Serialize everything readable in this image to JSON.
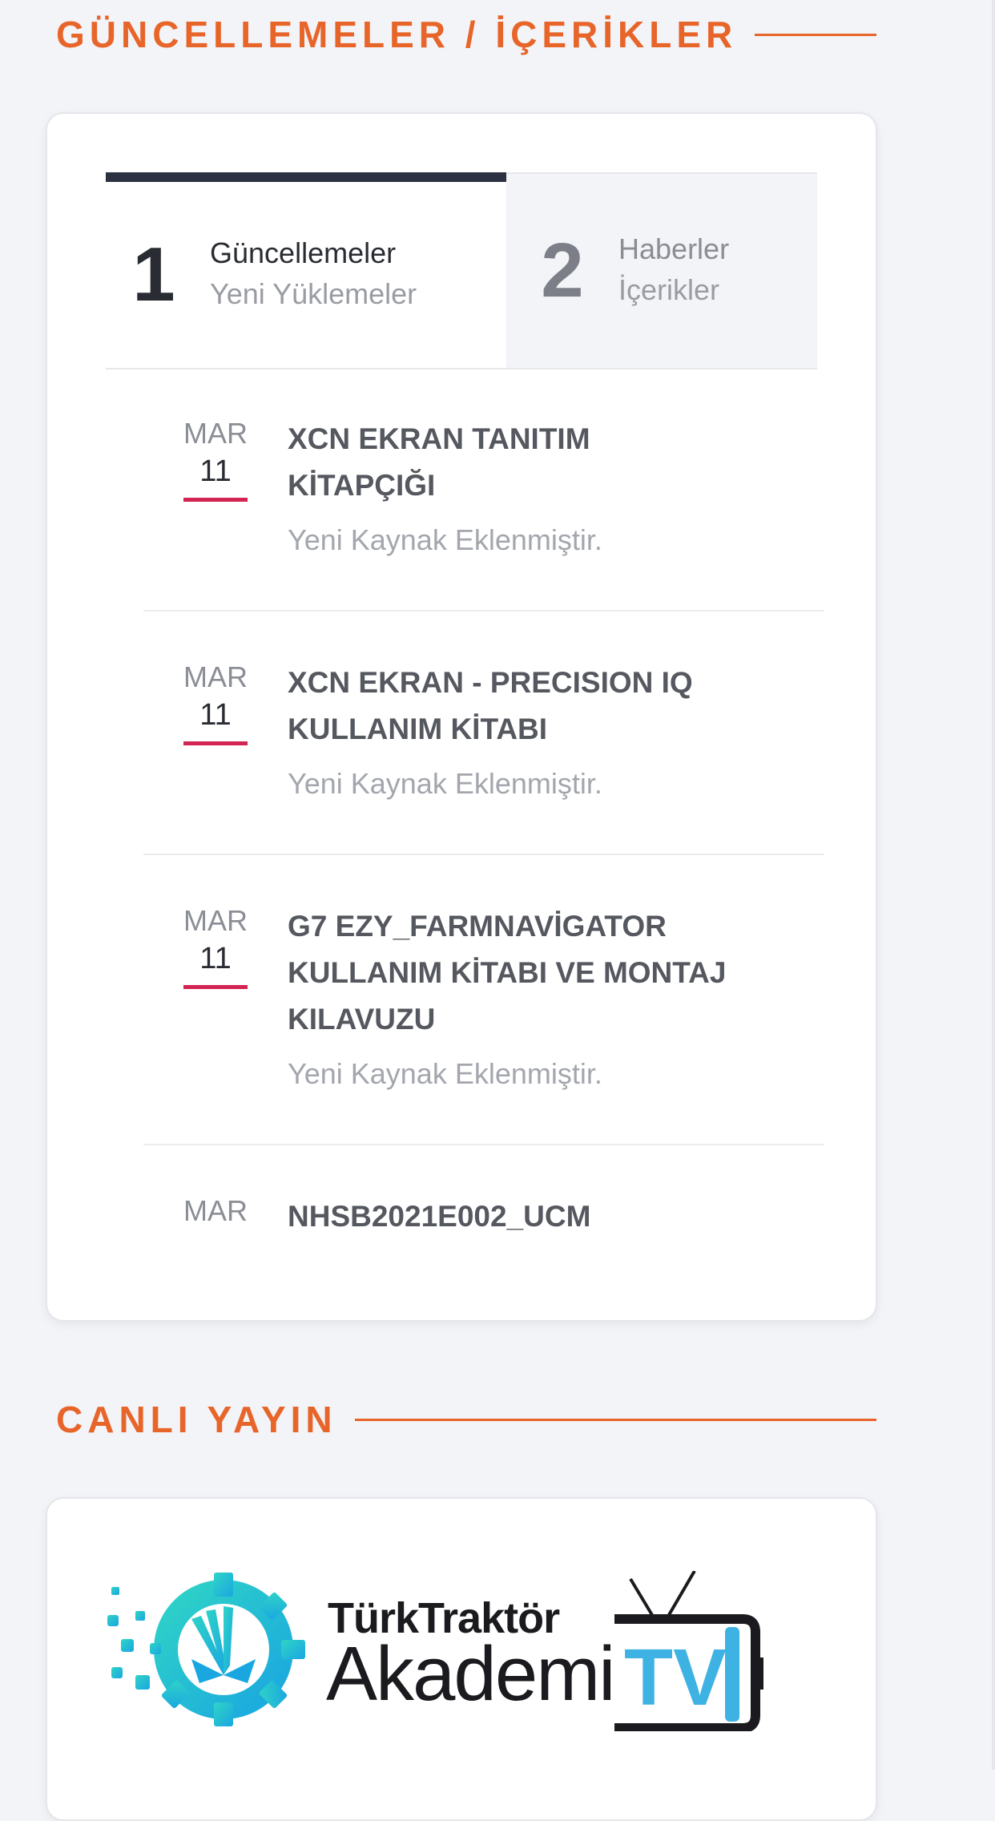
{
  "updates_section": {
    "heading": "GÜNCELLEMELER / İÇERİKLER",
    "tabs": [
      {
        "number": "1",
        "title": "Güncellemeler",
        "subtitle": "Yeni Yüklemeler",
        "active": true
      },
      {
        "number": "2",
        "title": "Haberler",
        "subtitle": "İçerikler",
        "active": false
      }
    ],
    "items": [
      {
        "month": "MAR",
        "day": "11",
        "title": "XCN EKRAN TANITIM KİTAPÇIĞI",
        "subtitle": "Yeni Kaynak Eklenmiştir."
      },
      {
        "month": "MAR",
        "day": "11",
        "title": "XCN EKRAN - PRECISION IQ KULLANIM KİTABI",
        "subtitle": "Yeni Kaynak Eklenmiştir."
      },
      {
        "month": "MAR",
        "day": "11",
        "title": "G7 EZY_FARMNAVİGATOR KULLANIM KİTABI VE MONTAJ KILAVUZU",
        "subtitle": "Yeni Kaynak Eklenmiştir."
      },
      {
        "month": "MAR",
        "day": "",
        "title": "NHSB2021E002_UCM",
        "subtitle": ""
      }
    ]
  },
  "live_section": {
    "heading": "CANLI YAYIN",
    "logo": {
      "line1": "TürkTraktör",
      "line2": "Akademi",
      "tv": "TV"
    }
  },
  "colors": {
    "accent_orange": "#e8652a",
    "date_underline": "#d22554",
    "tab_active_bar": "#2c3142",
    "logo_blue": "#3eb2e3"
  }
}
